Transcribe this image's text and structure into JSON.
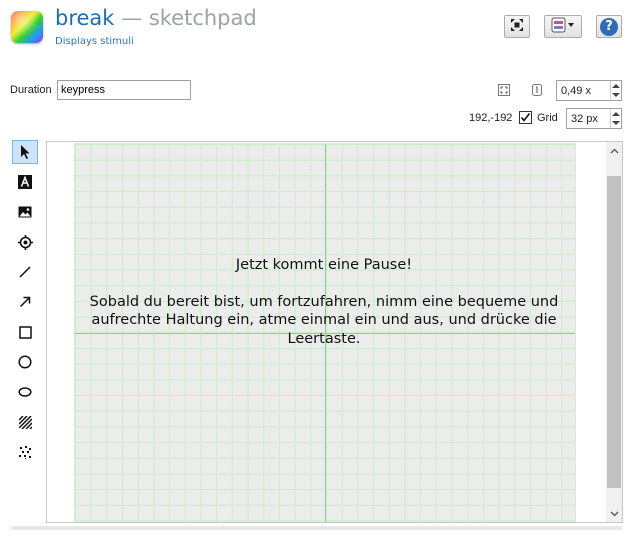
{
  "header": {
    "item_name": "break",
    "separator": " — ",
    "item_type": "sketchpad",
    "description": "Displays stimuli",
    "buttons": [
      {
        "name": "expand-icon"
      },
      {
        "name": "view-toggle-icon"
      },
      {
        "name": "help-icon",
        "label": "?"
      }
    ]
  },
  "settings": {
    "duration_label": "Duration",
    "duration_value": "keypress",
    "zoom_value": "0,49 x",
    "cursor_coords": "192,-192",
    "grid_label": "Grid",
    "grid_checked": true,
    "grid_size": "32 px"
  },
  "tools": [
    {
      "name": "arrow-pointer-icon",
      "active": true
    },
    {
      "name": "text-tool-icon"
    },
    {
      "name": "image-tool-icon"
    },
    {
      "name": "fixdot-tool-icon"
    },
    {
      "name": "line-tool-icon"
    },
    {
      "name": "arrow-tool-icon"
    },
    {
      "name": "rectangle-tool-icon"
    },
    {
      "name": "circle-tool-icon"
    },
    {
      "name": "ellipse-tool-icon"
    },
    {
      "name": "gabor-tool-icon"
    },
    {
      "name": "noise-patch-tool-icon"
    }
  ],
  "canvas": {
    "text_line1": "Jetzt kommt eine Pause!",
    "text_line2": "Sobald du bereit bist, um fortzufahren, nimm eine bequeme und",
    "text_line3": "aufrechte Haltung ein, atme einmal ein und aus, und drücke die",
    "text_line4": "Leertaste.",
    "background_color": "#ececec",
    "grid_color": "#c9edc9",
    "axis_color": "#8fd08f"
  }
}
